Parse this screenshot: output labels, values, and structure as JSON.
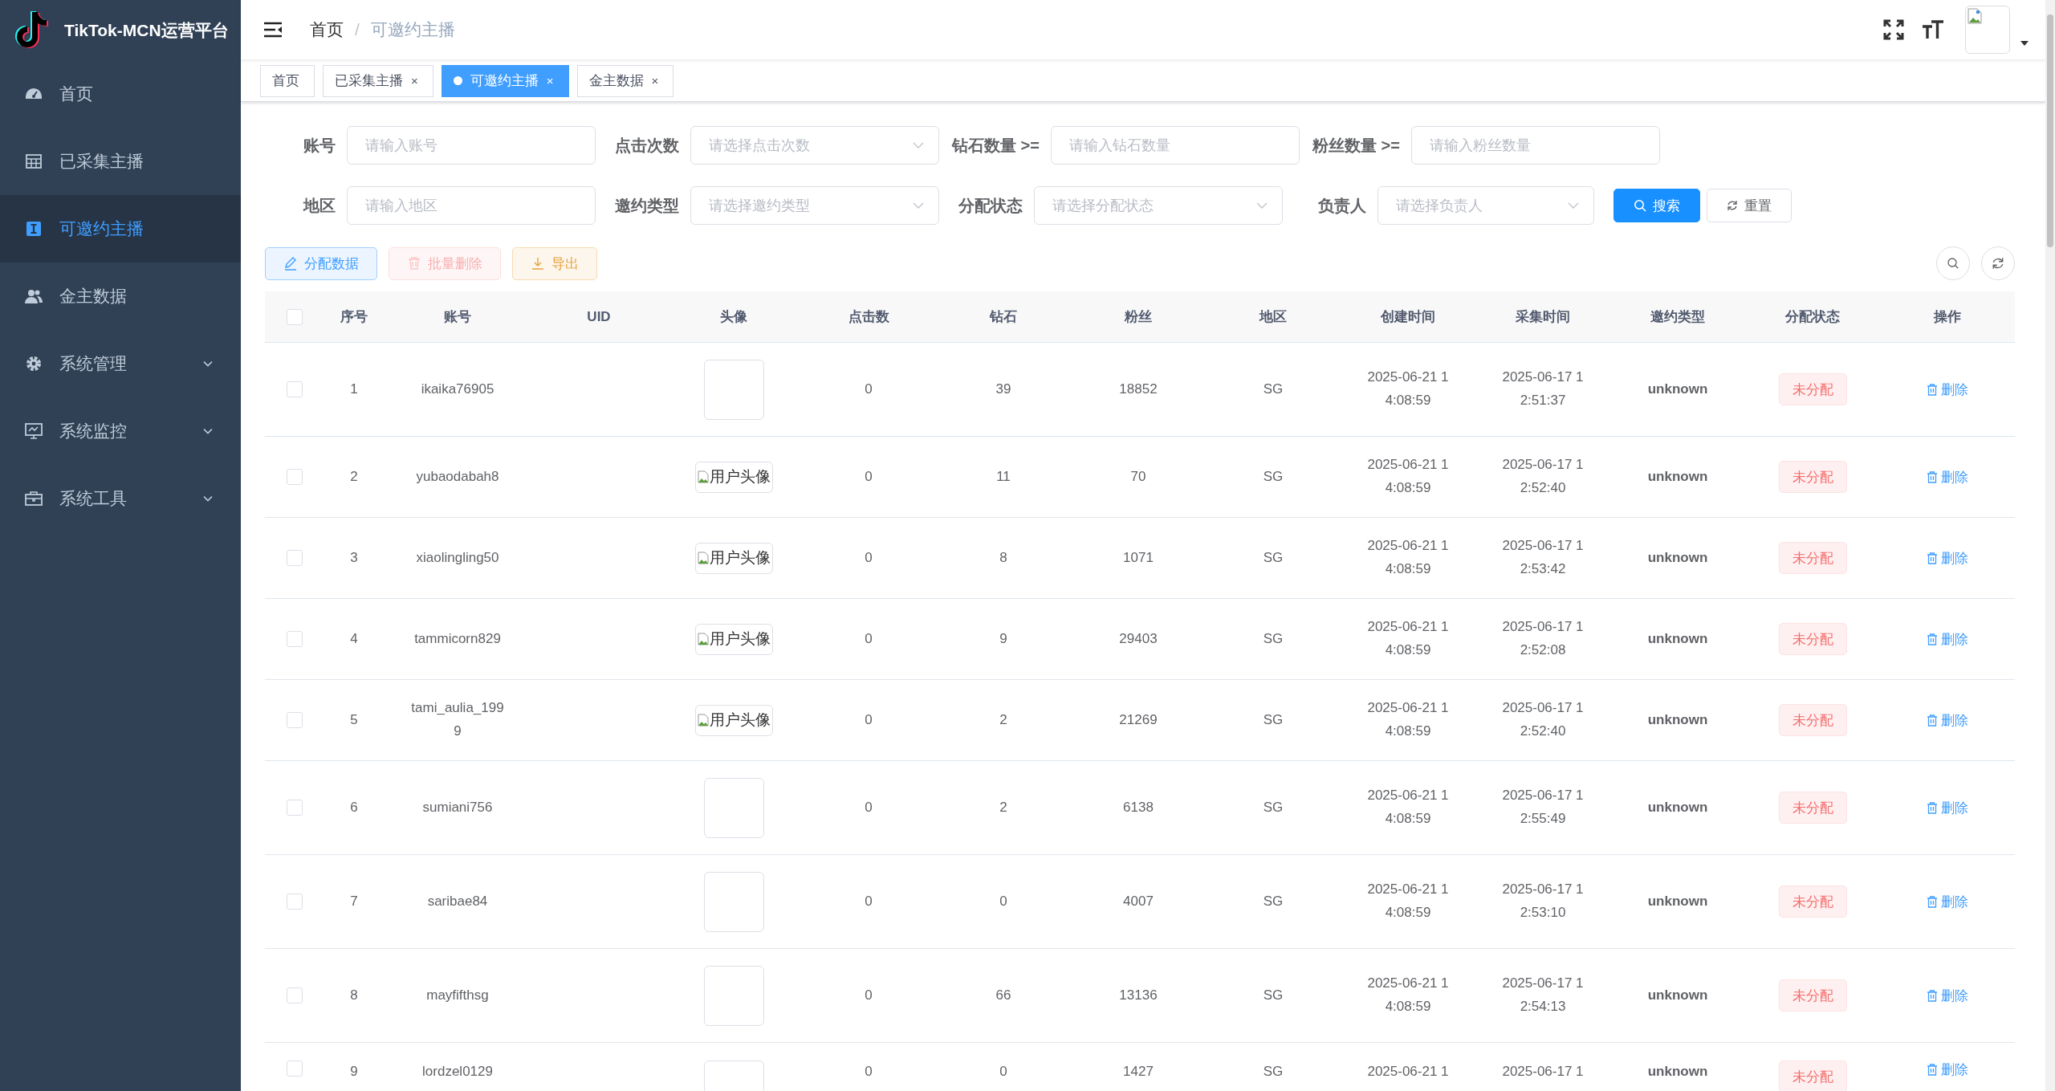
{
  "app": {
    "title": "TikTok-MCN运营平台"
  },
  "sidebar": {
    "items": [
      {
        "label": "首页",
        "kind": "link",
        "selected": false
      },
      {
        "label": "已采集主播",
        "kind": "link",
        "selected": false
      },
      {
        "label": "可邀约主播",
        "kind": "link",
        "selected": true
      },
      {
        "label": "金主数据",
        "kind": "link",
        "selected": false
      },
      {
        "label": "系统管理",
        "kind": "submenu",
        "selected": false
      },
      {
        "label": "系统监控",
        "kind": "submenu",
        "selected": false
      },
      {
        "label": "系统工具",
        "kind": "submenu",
        "selected": false
      }
    ]
  },
  "header": {
    "breadcrumb": [
      "首页",
      "可邀约主播"
    ],
    "separator": "/"
  },
  "tabs": [
    {
      "label": "首页",
      "selected": false
    },
    {
      "label": "已采集主播",
      "selected": false,
      "close_mark": "×"
    },
    {
      "label": "可邀约主播",
      "selected": true,
      "close_mark": "×"
    },
    {
      "label": "金主数据",
      "selected": false,
      "close_mark": "×"
    }
  ],
  "filters": [
    [
      {
        "label": "账号",
        "kind": "input",
        "placeholder": "请输入账号"
      },
      {
        "label": "点击次数",
        "kind": "select",
        "placeholder": "请选择点击次数"
      },
      {
        "label": "钻石数量 >=",
        "kind": "input",
        "placeholder": "请输入钻石数量"
      },
      {
        "label": "粉丝数量 >=",
        "kind": "input",
        "placeholder": "请输入粉丝数量"
      }
    ],
    [
      {
        "label": "地区",
        "kind": "input",
        "placeholder": "请输入地区"
      },
      {
        "label": "邀约类型",
        "kind": "select",
        "placeholder": "请选择邀约类型"
      },
      {
        "label": "分配状态",
        "kind": "select",
        "placeholder": "请选择分配状态"
      },
      {
        "label": "负责人",
        "kind": "select",
        "placeholder": "请选择负责人"
      }
    ]
  ],
  "filter_buttons": [
    {
      "label": "搜索",
      "kind": "search"
    },
    {
      "label": "重置",
      "kind": "reset"
    }
  ],
  "toolbar": [
    {
      "label": "分配数据",
      "kind": "assign",
      "disabled": false
    },
    {
      "label": "批量删除",
      "kind": "delete",
      "disabled": true
    },
    {
      "label": "导出",
      "kind": "export",
      "disabled": false
    }
  ],
  "table": {
    "all_checked": false,
    "columns": [
      "序号",
      "账号",
      "UID",
      "头像",
      "点击数",
      "钻石",
      "粉丝",
      "地区",
      "创建时间",
      "采集时间",
      "邀约类型",
      "分配状态",
      "操作"
    ],
    "rows": [
      {
        "checked": false,
        "index": "1",
        "account": "ikaika76905",
        "avatar": {
          "kind": "blank"
        },
        "clicks": "0",
        "diamonds": "39",
        "fans": "18852",
        "region": "SG",
        "created": "2025-06-21 14:08:59",
        "collected": "2025-06-17 12:51:37",
        "invite_type": "unknown",
        "status": "未分配",
        "action": "删除"
      },
      {
        "checked": false,
        "index": "2",
        "account": "yubaodabah8",
        "avatar": {
          "kind": "broken",
          "alt": "用户头像"
        },
        "clicks": "0",
        "diamonds": "11",
        "fans": "70",
        "region": "SG",
        "created": "2025-06-21 14:08:59",
        "collected": "2025-06-17 12:52:40",
        "invite_type": "unknown",
        "status": "未分配",
        "action": "删除"
      },
      {
        "checked": false,
        "index": "3",
        "account": "xiaolingling50",
        "avatar": {
          "kind": "broken",
          "alt": "用户头像"
        },
        "clicks": "0",
        "diamonds": "8",
        "fans": "1071",
        "region": "SG",
        "created": "2025-06-21 14:08:59",
        "collected": "2025-06-17 12:53:42",
        "invite_type": "unknown",
        "status": "未分配",
        "action": "删除"
      },
      {
        "checked": false,
        "index": "4",
        "account": "tammicorn829",
        "avatar": {
          "kind": "broken",
          "alt": "用户头像"
        },
        "clicks": "0",
        "diamonds": "9",
        "fans": "29403",
        "region": "SG",
        "created": "2025-06-21 14:08:59",
        "collected": "2025-06-17 12:52:08",
        "invite_type": "unknown",
        "status": "未分配",
        "action": "删除"
      },
      {
        "checked": false,
        "index": "5",
        "account": "tami_aulia_1999",
        "avatar": {
          "kind": "broken",
          "alt": "用户头像"
        },
        "clicks": "0",
        "diamonds": "2",
        "fans": "21269",
        "region": "SG",
        "created": "2025-06-21 14:08:59",
        "collected": "2025-06-17 12:52:40",
        "invite_type": "unknown",
        "status": "未分配",
        "action": "删除"
      },
      {
        "checked": false,
        "index": "6",
        "account": "sumiani756",
        "avatar": {
          "kind": "blank"
        },
        "clicks": "0",
        "diamonds": "2",
        "fans": "6138",
        "region": "SG",
        "created": "2025-06-21 14:08:59",
        "collected": "2025-06-17 12:55:49",
        "invite_type": "unknown",
        "status": "未分配",
        "action": "删除"
      },
      {
        "checked": false,
        "index": "7",
        "account": "saribae84",
        "avatar": {
          "kind": "blank"
        },
        "clicks": "0",
        "diamonds": "0",
        "fans": "4007",
        "region": "SG",
        "created": "2025-06-21 14:08:59",
        "collected": "2025-06-17 12:53:10",
        "invite_type": "unknown",
        "status": "未分配",
        "action": "删除"
      },
      {
        "checked": false,
        "index": "8",
        "account": "mayfifthsg",
        "avatar": {
          "kind": "blank"
        },
        "clicks": "0",
        "diamonds": "66",
        "fans": "13136",
        "region": "SG",
        "created": "2025-06-21 14:08:59",
        "collected": "2025-06-17 12:54:13",
        "invite_type": "unknown",
        "status": "未分配",
        "action": "删除"
      },
      {
        "checked": false,
        "index": "9",
        "account": "lordzel0129",
        "avatar": {
          "kind": "blank"
        },
        "clicks": "0",
        "diamonds": "0",
        "fans": "1427",
        "region": "SG",
        "created": "2025-06-21 1",
        "collected": "2025-06-17 1",
        "invite_type": "unknown",
        "status": "未分配",
        "action": "删除"
      }
    ]
  }
}
